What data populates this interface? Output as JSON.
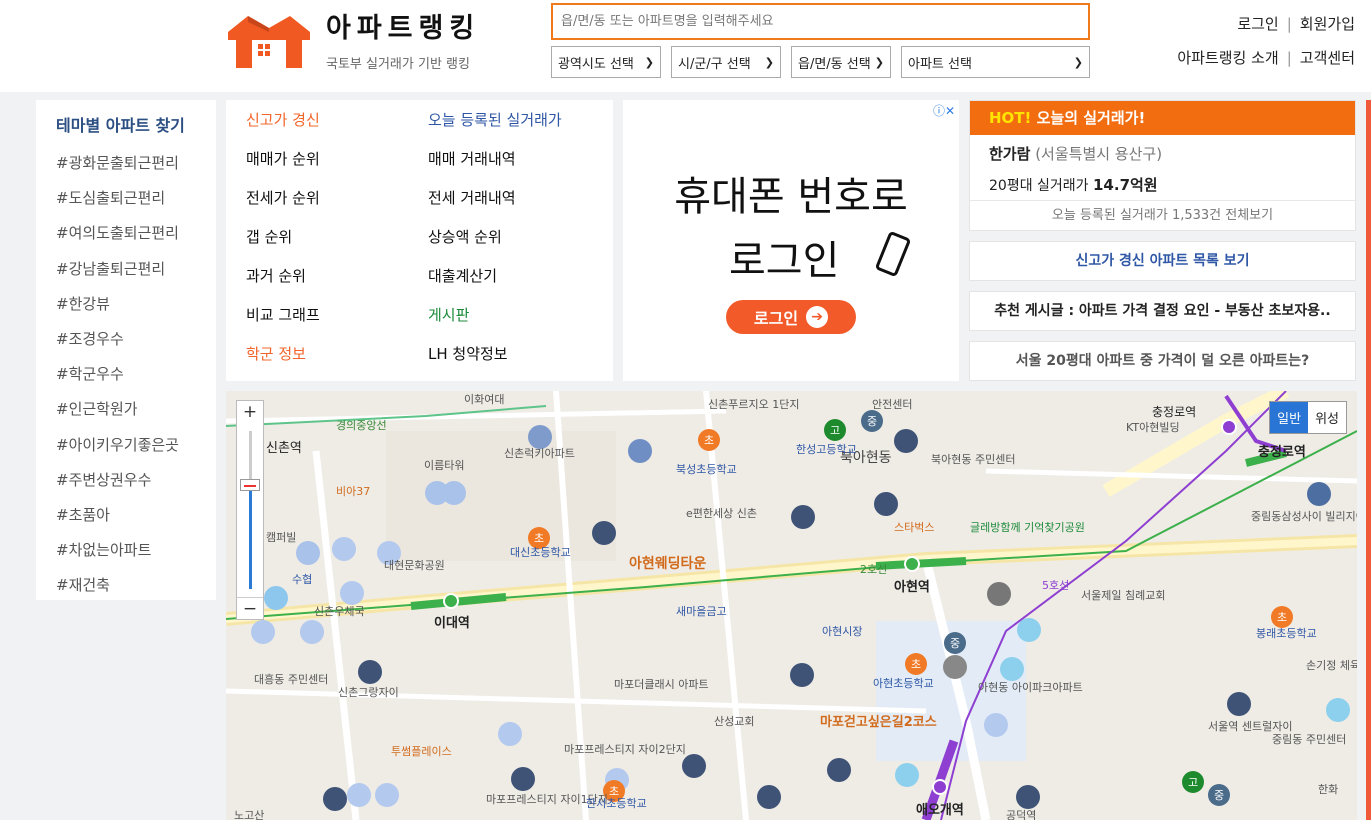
{
  "header": {
    "brand": "아파트랭킹",
    "tagline": "국토부 실거래가 기반 랭킹",
    "search_placeholder": "읍/면/동 또는 아파트명을 입력해주세요",
    "selects": [
      "광역시도 선택",
      "시/군/구 선택",
      "읍/면/동 선택",
      "아파트 선택"
    ],
    "login": "로그인",
    "signup": "회원가입",
    "about": "아파트랭킹 소개",
    "support": "고객센터",
    "separator": "|"
  },
  "theme": {
    "title": "테마별 아파트 찾기",
    "tags": [
      "#광화문출퇴근편리",
      "#도심출퇴근편리",
      "#여의도출퇴근편리",
      "#강남출퇴근편리",
      "#한강뷰",
      "#조경우수",
      "#학군우수",
      "#인근학원가",
      "#아이키우기좋은곳",
      "#주변상권우수",
      "#초품아",
      "#차없는아파트",
      "#재건축"
    ]
  },
  "menu": {
    "left": [
      "신고가 경신",
      "매매가 순위",
      "전세가 순위",
      "갭 순위",
      "과거 순위",
      "비교 그래프",
      "학군 정보"
    ],
    "right": [
      "오늘 등록된 실거래가",
      "매매 거래내역",
      "전세 거래내역",
      "상승액 순위",
      "대출계산기",
      "게시판",
      "LH 청약정보"
    ]
  },
  "ad": {
    "line1": "휴대폰 번호로",
    "line2": "로그인",
    "button": "로그인",
    "info": "ⓘ✕"
  },
  "hot": {
    "prefix": "HOT!",
    "title": "오늘의 실거래가!",
    "apt": "한가람",
    "region": "(서울특별시 용산구)",
    "deal_prefix": "20평대 실거래가",
    "deal_price": "14.7억원",
    "footer": "오늘 등록된 실거래가 1,533건 전체보기"
  },
  "right_links": [
    "신고가 경신 아파트 목록 보기",
    "추천 게시글 : 아파트 가격 결정 요인 - 부동산 초보자용..",
    "서울 20평대 아파트 중 가격이 덜 오른 아파트는?"
  ],
  "map": {
    "type_normal": "일반",
    "type_satellite": "위성",
    "zoom_in": "+",
    "zoom_out": "−",
    "labels": [
      "이대역",
      "아현역",
      "충정로역",
      "애오개역",
      "북아현동",
      "아현웨딩타운",
      "신촌역",
      "이화여대",
      "북성초등학교",
      "한성고등학교",
      "대신초등학교",
      "신촌푸르지오 1단지",
      "e편한세상 신촌",
      "스타벅스",
      "글레방함께 기억찾기공원",
      "서울제일 침례교회",
      "봉래초등학교",
      "중림동삼성사이 빌리지아파트",
      "마포더클래시 아파트",
      "산성교회",
      "마포프레스티지 자이2단지",
      "마포프레스티지 자이1단지",
      "마포걷고싶은길2코스",
      "아현시장",
      "새마을금고",
      "신촌그랑자이",
      "대흥동 주민센터",
      "투썸플레이스",
      "이름타워",
      "비아37",
      "캠퍼빌",
      "수협",
      "대현문화공원",
      "신촌우체국",
      "아현초등학교",
      "서울역 센트럴자이",
      "중림동 주민센터",
      "손기정 체육공원",
      "KT아현빌딩",
      "북아현동 주민센터",
      "안전센터",
      "충정로역",
      "2호선",
      "5호선",
      "경의중앙선",
      "신촌럭키아파트",
      "한서초등학교",
      "아현동 아이파크아파트",
      "한화",
      "공덕역",
      "노고산"
    ],
    "badges": {
      "elementary": "초",
      "middle": "중",
      "high": "고"
    }
  },
  "colors": {
    "accent": "#f26d10",
    "brand_blue": "#2c4f83",
    "line2": "#3cb04a",
    "line5": "#8e3fd1"
  }
}
